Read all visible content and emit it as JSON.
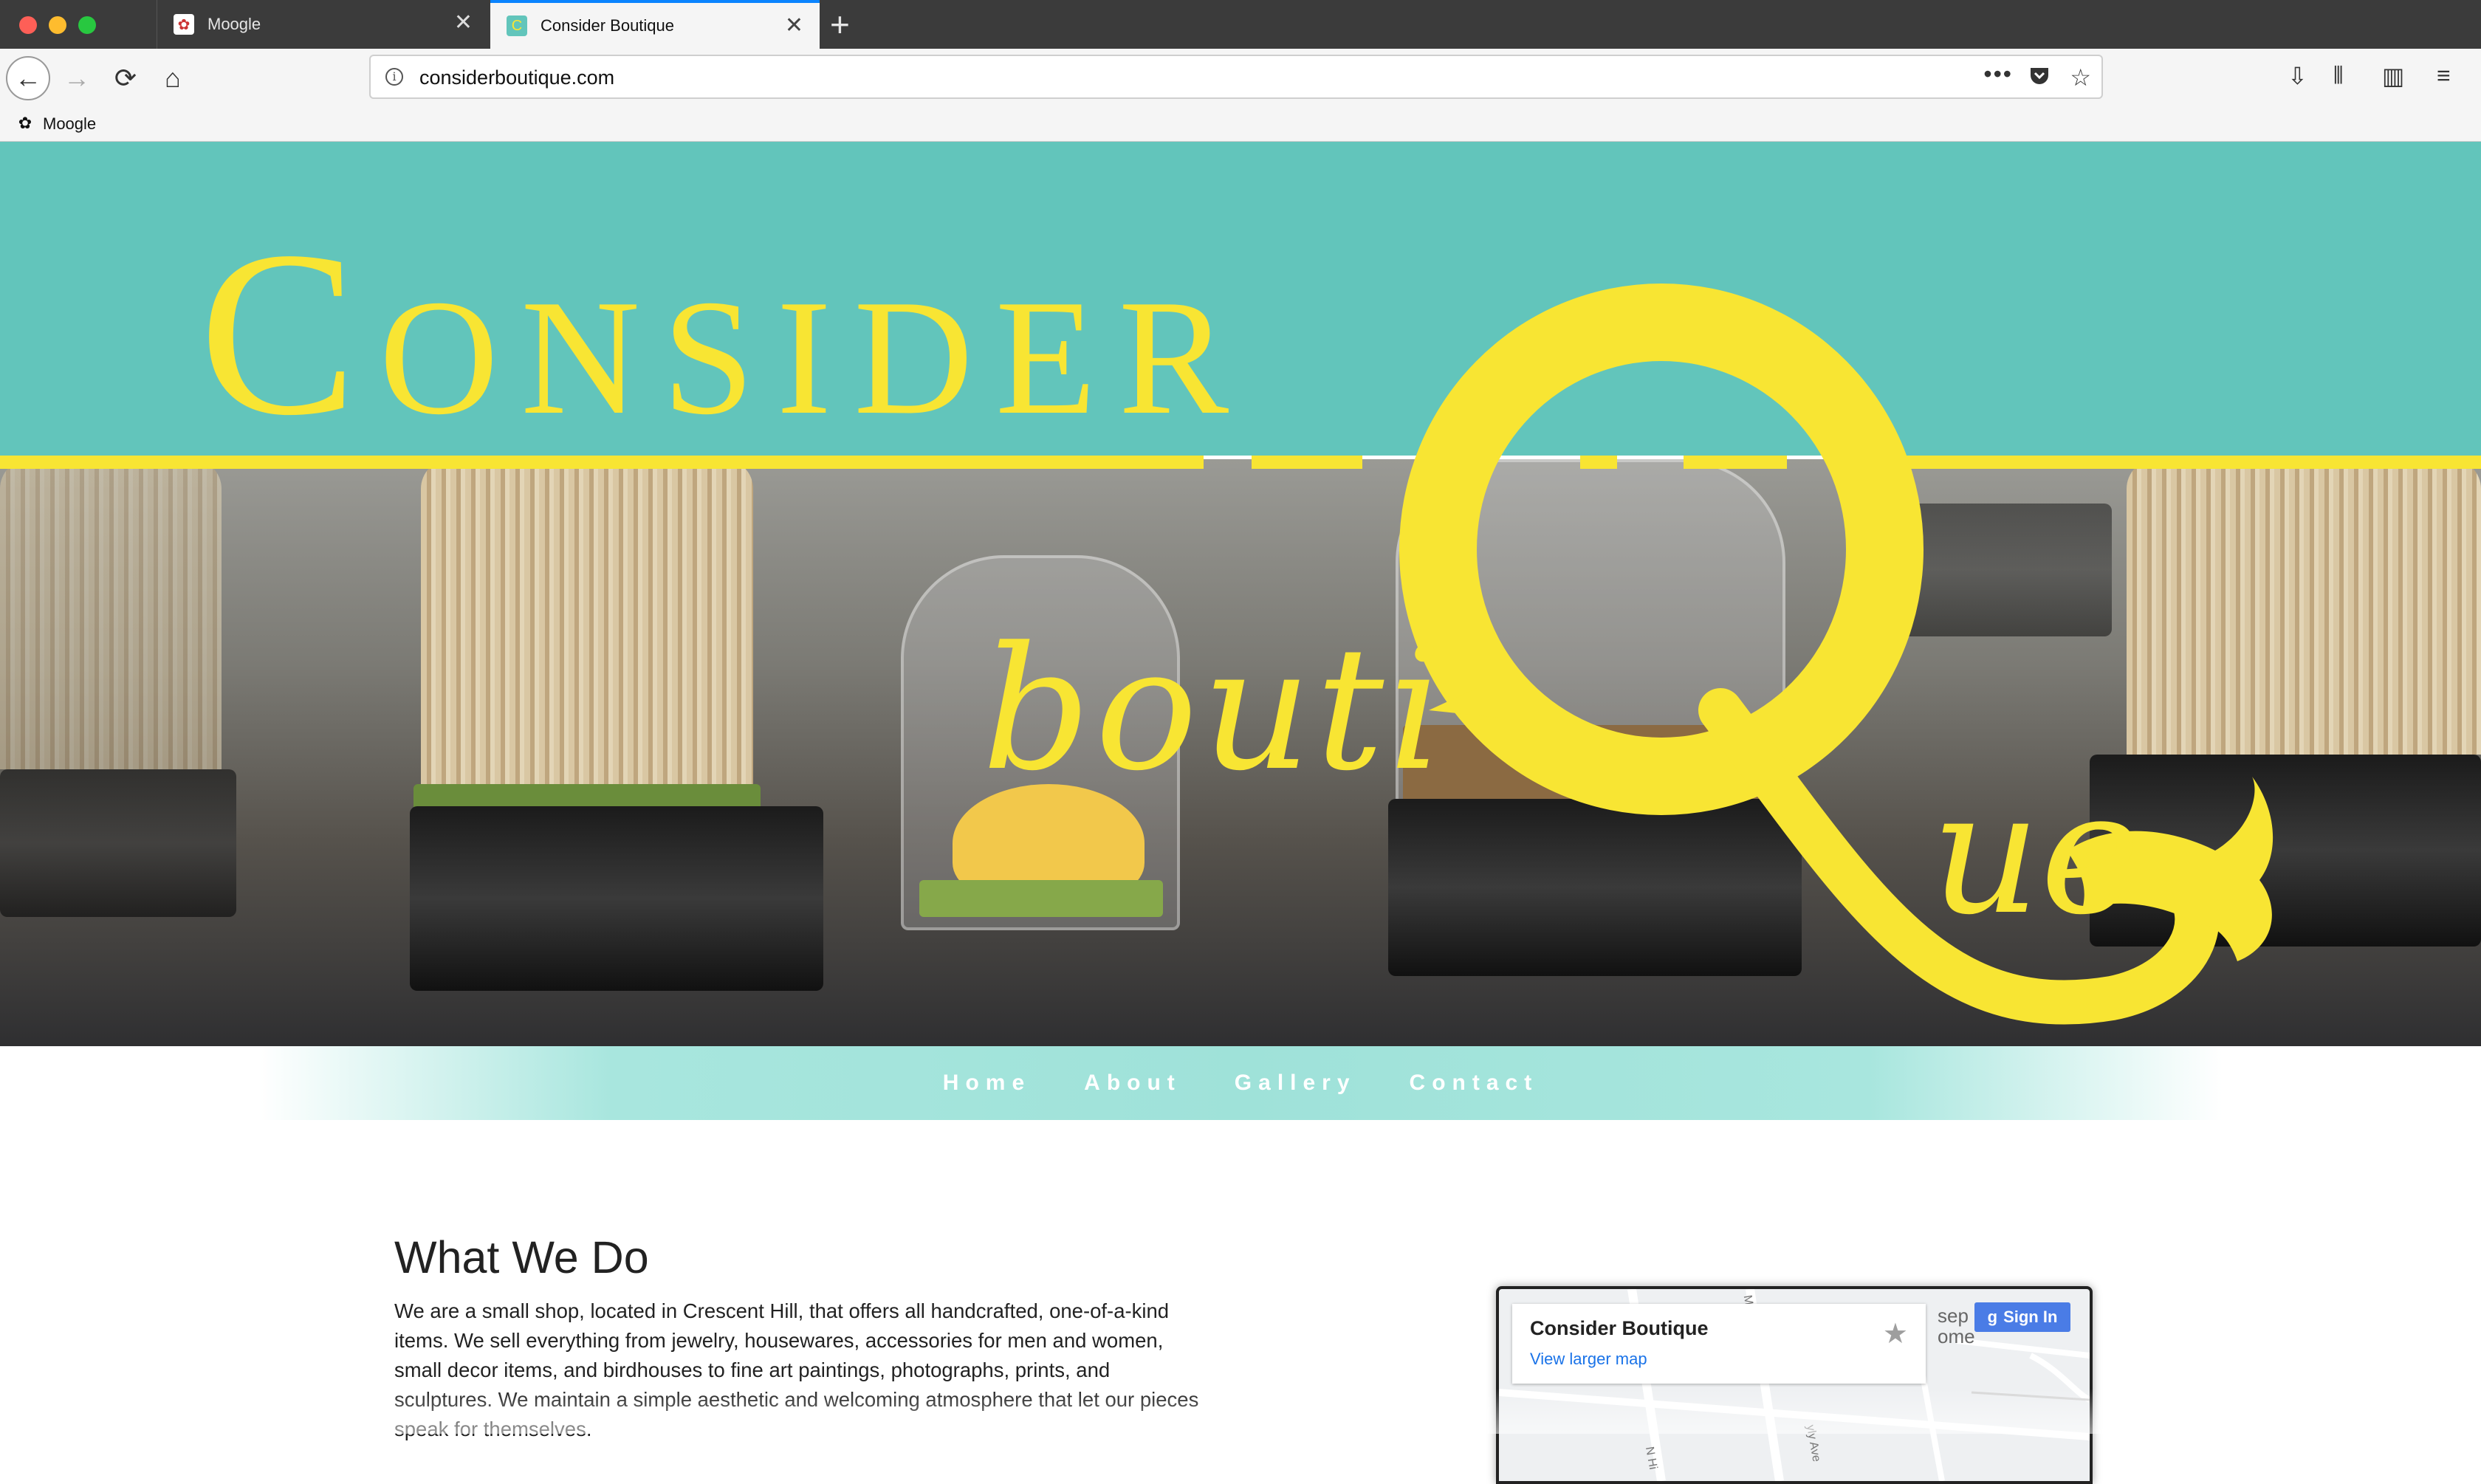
{
  "browser": {
    "tabs": [
      {
        "title": "Moogle",
        "favicon": "moogle-icon"
      },
      {
        "title": "Consider Boutique",
        "favicon": "consider-favicon",
        "active": true
      }
    ],
    "url": "considerboutique.com",
    "bookmarks": [
      {
        "label": "Moogle",
        "favicon": "moogle-icon"
      }
    ]
  },
  "logo": {
    "consider": "Consider",
    "bouti": "bouti",
    "ue": "ue"
  },
  "nav": {
    "items": [
      "Home",
      "About",
      "Gallery",
      "Contact"
    ]
  },
  "main": {
    "title": "What We Do",
    "body": "We are a small shop, located in Crescent Hill, that offers all handcrafted, one-of-a-kind items. We sell everything from jewelry, housewares, accessories for men and women, small decor items, and birdhouses to fine art paintings, photographs, prints, and sculptures. We maintain a simple aesthetic and welcoming atmosphere that let our pieces speak for themselves."
  },
  "map": {
    "place_name": "Consider Boutique",
    "larger_map_link": "View larger map",
    "signin_label": "Sign In",
    "snippet_line1": "sep",
    "snippet_line2": "ome",
    "street_a": "N Hi",
    "street_b": "yly Ave",
    "street_c": "M"
  },
  "colors": {
    "teal": "#62c5bb",
    "yellow": "#f8e533",
    "menu_teal": "#9fe2d9",
    "link_blue": "#1a73e8"
  }
}
